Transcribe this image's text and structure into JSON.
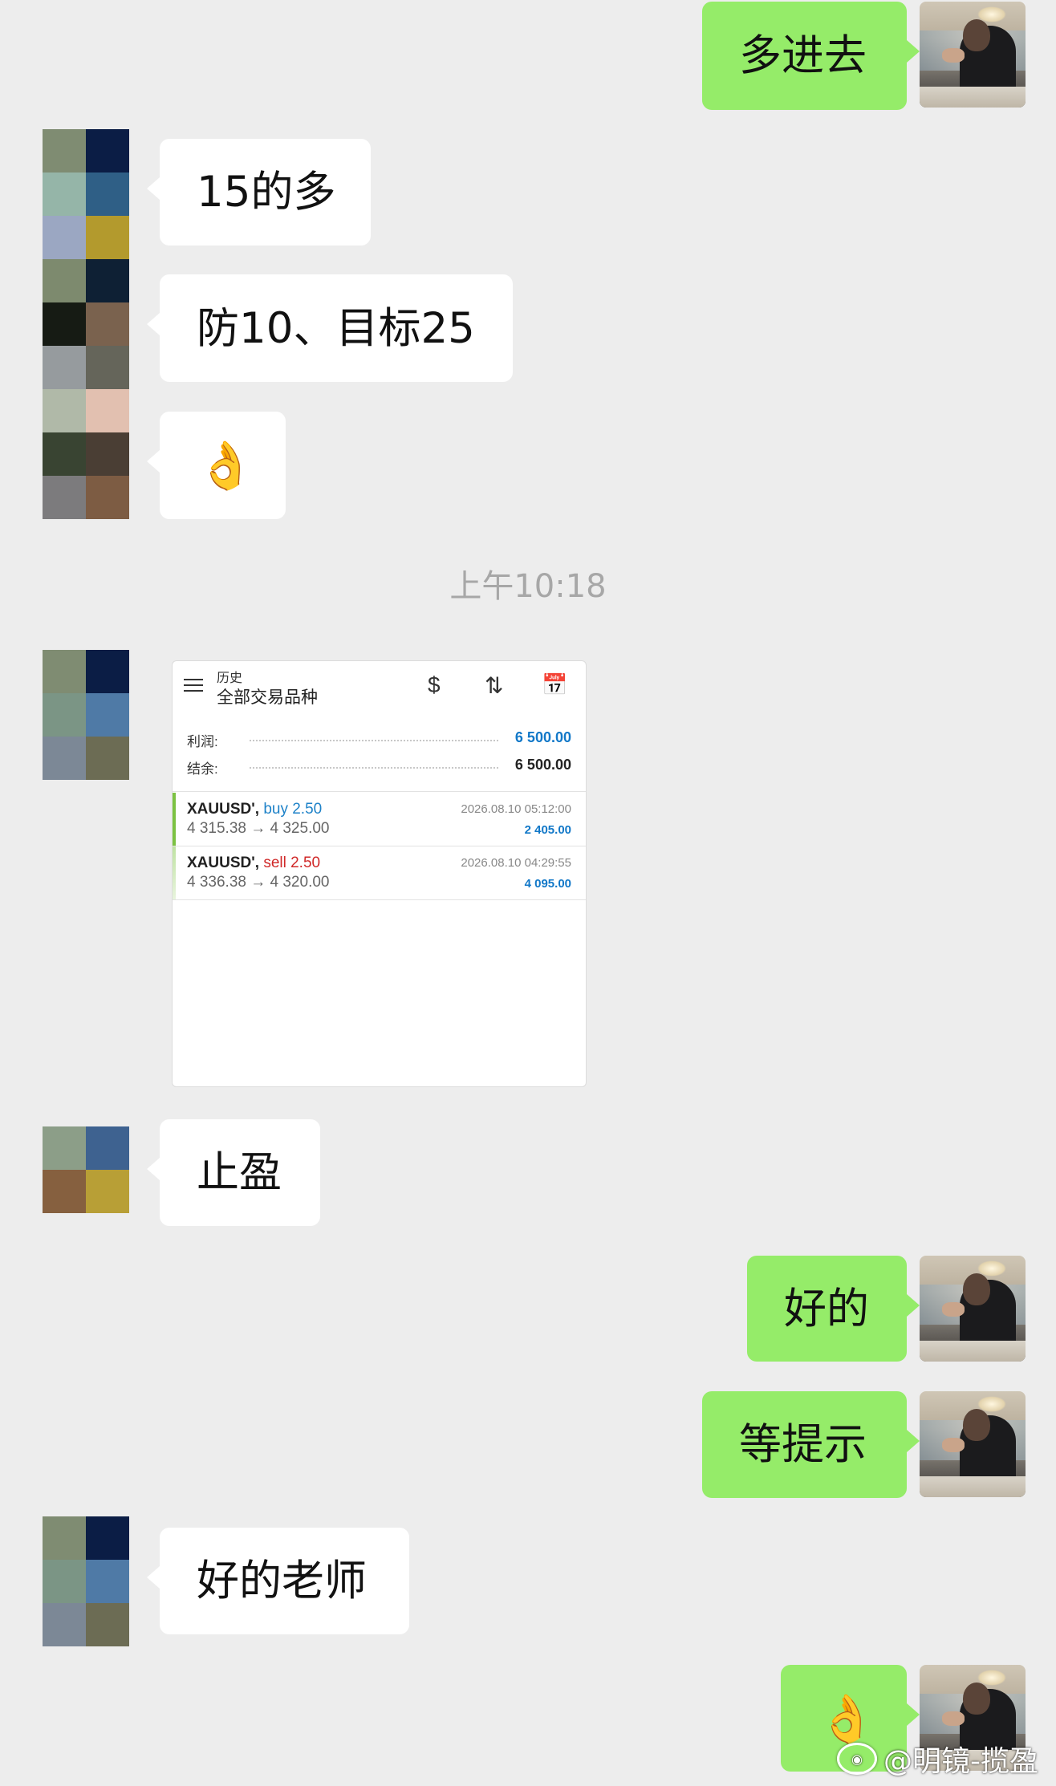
{
  "messages": {
    "m1": "多进去",
    "m2": "15的多",
    "m3": "防10、目标25",
    "m4": "👌",
    "m5": "止盈",
    "m6": "好的",
    "m7": "等提示",
    "m8": "好的老师",
    "m9": "👌"
  },
  "timestamp": "上午10:18",
  "trade_card": {
    "section": "历史",
    "filter": "全部交易品种",
    "icons": [
      "dollar-sort-icon",
      "sort-icon",
      "calendar-icon"
    ],
    "profit_label": "利润:",
    "profit_value": "6 500.00",
    "balance_label": "结余:",
    "balance_value": "6 500.00",
    "trades": [
      {
        "symbol": "XAUUSD',",
        "direction": "buy 2.50",
        "prices": "4 315.38 → 4 325.00",
        "datetime": "2026.08.10 05:12:00",
        "pl": "2 405.00"
      },
      {
        "symbol": "XAUUSD',",
        "direction": "sell 2.50",
        "prices": "4 336.38 → 4 320.00",
        "datetime": "2026.08.10 04:29:55",
        "pl": "4 095.00"
      }
    ]
  },
  "colors": {
    "bubble_out": "#95ec69",
    "bubble_in": "#ffffff",
    "background": "#ededed",
    "buy": "#1e82c8",
    "sell": "#d02828",
    "profit": "#1278c8"
  },
  "watermark": "@明镜-揽盈"
}
